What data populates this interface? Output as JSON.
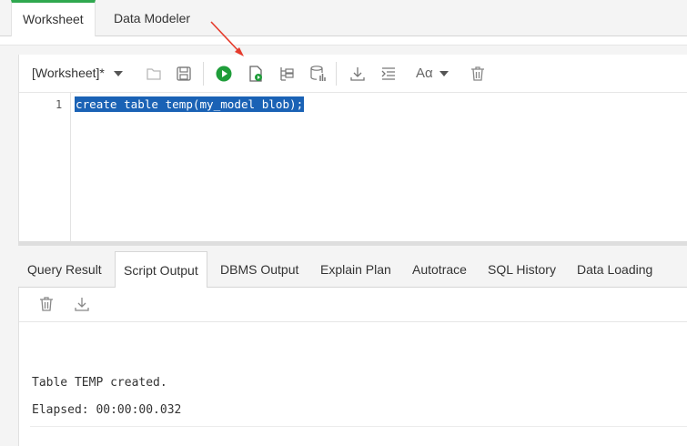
{
  "top_tabs": [
    {
      "label": "Worksheet",
      "active": true
    },
    {
      "label": "Data Modeler",
      "active": false
    }
  ],
  "toolbar": {
    "worksheet_selector": "[Worksheet]*",
    "font_size_label": "Aα",
    "icons": [
      "folder-open-icon",
      "save-icon",
      "run-statement-icon",
      "run-script-icon",
      "explain-plan-icon",
      "autotrace-icon",
      "download-icon",
      "format-icon",
      "font-size-icon",
      "clear-icon"
    ]
  },
  "editor": {
    "lines": [
      {
        "number": "1",
        "text": "create table temp(my_model blob);",
        "selected": true
      }
    ]
  },
  "bottom_tabs": [
    {
      "label": "Query Result",
      "active": false
    },
    {
      "label": "Script Output",
      "active": true
    },
    {
      "label": "DBMS Output",
      "active": false
    },
    {
      "label": "Explain Plan",
      "active": false
    },
    {
      "label": "Autotrace",
      "active": false
    },
    {
      "label": "SQL History",
      "active": false
    },
    {
      "label": "Data Loading",
      "active": false
    }
  ],
  "output": {
    "lines": [
      "Table TEMP created.",
      "Elapsed: 00:00:00.032"
    ]
  },
  "colors": {
    "accent_green": "#2fa84f",
    "selection_blue": "#1a62b5",
    "annotation_red": "#e53b2c"
  }
}
